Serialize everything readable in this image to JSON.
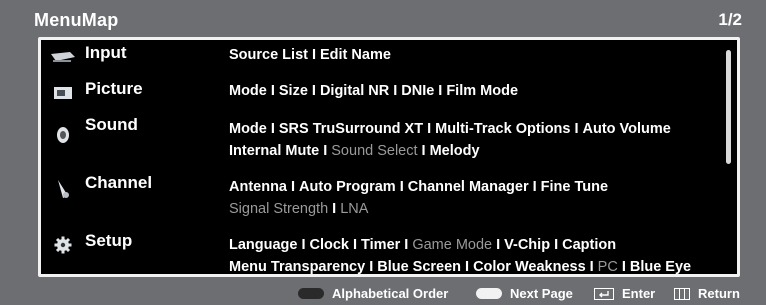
{
  "header": {
    "title": "MenuMap",
    "page": "1/2"
  },
  "categories": [
    {
      "name": "Input",
      "icon": "input-icon",
      "lines": [
        [
          {
            "t": "Source List",
            "d": false
          },
          {
            "t": "Edit Name",
            "d": false
          }
        ]
      ]
    },
    {
      "name": "Picture",
      "icon": "picture-icon",
      "lines": [
        [
          {
            "t": "Mode",
            "d": false
          },
          {
            "t": "Size",
            "d": false
          },
          {
            "t": "Digital NR",
            "d": false
          },
          {
            "t": "DNIe",
            "d": false
          },
          {
            "t": "Film Mode",
            "d": false
          }
        ]
      ]
    },
    {
      "name": "Sound",
      "icon": "sound-icon",
      "lines": [
        [
          {
            "t": "Mode",
            "d": false
          },
          {
            "t": "SRS TruSurround XT",
            "d": false
          },
          {
            "t": "Multi-Track Options",
            "d": false
          },
          {
            "t": "Auto Volume",
            "d": false
          }
        ],
        [
          {
            "t": "Internal Mute",
            "d": false
          },
          {
            "t": "Sound Select",
            "d": true
          },
          {
            "t": "Melody",
            "d": false
          }
        ]
      ]
    },
    {
      "name": "Channel",
      "icon": "channel-icon",
      "lines": [
        [
          {
            "t": "Antenna",
            "d": false
          },
          {
            "t": "Auto Program",
            "d": false
          },
          {
            "t": "Channel Manager",
            "d": false
          },
          {
            "t": "Fine Tune",
            "d": false
          }
        ],
        [
          {
            "t": "Signal Strength",
            "d": true
          },
          {
            "t": "LNA",
            "d": true
          }
        ]
      ]
    },
    {
      "name": "Setup",
      "icon": "setup-icon",
      "lines": [
        [
          {
            "t": "Language",
            "d": false
          },
          {
            "t": "Clock",
            "d": false
          },
          {
            "t": "Timer",
            "d": false
          },
          {
            "t": "Game Mode",
            "d": true
          },
          {
            "t": "V-Chip",
            "d": false
          },
          {
            "t": "Caption",
            "d": false
          }
        ],
        [
          {
            "t": "Menu Transparency",
            "d": false
          },
          {
            "t": "Blue Screen",
            "d": false
          },
          {
            "t": "Color Weakness",
            "d": false
          },
          {
            "t": "PC",
            "d": true
          },
          {
            "t": "Blue Eye",
            "d": false
          }
        ]
      ]
    }
  ],
  "separator": "I",
  "footer": {
    "alpha_label": "Alphabetical Order",
    "next_label": "Next Page",
    "enter_label": "Enter",
    "return_label": "Return"
  },
  "colors": {
    "background": "#6d6e72",
    "panel": "#000000",
    "dimmed": "#9a9a9a",
    "text": "#ffffff"
  }
}
